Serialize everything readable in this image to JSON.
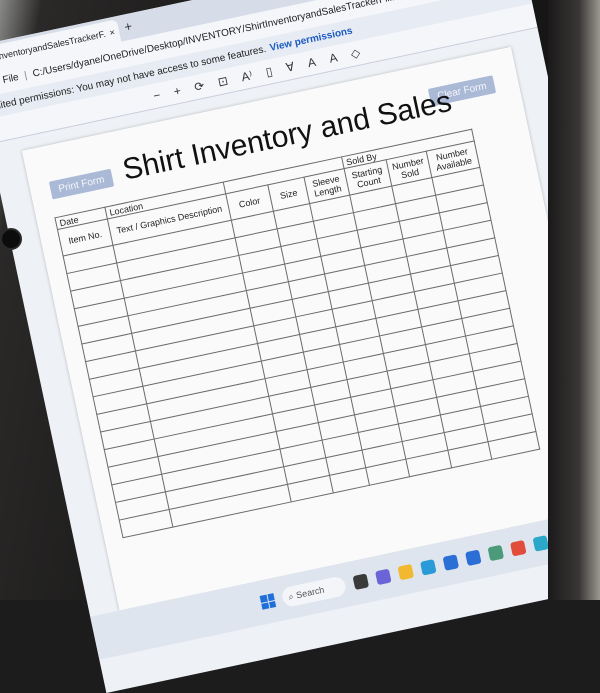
{
  "browser": {
    "tab_title": "ShirtInventoryandSalesTrackerF...",
    "tab_close": "×",
    "new_tab": "+",
    "file_label": "File",
    "file_path": "C:/Users/dyane/OneDrive/Desktop/INVENTORY/ShirtInventoryandSalesTrackerFillable.pdf",
    "permission_text": "limited permissions: You may not have access to some features.",
    "permission_link": "View permissions"
  },
  "pdf_toolbar": {
    "zoom_out": "−",
    "zoom_in": "+",
    "rotate": "⟳",
    "fit": "⊡",
    "read_aloud": "A⁾",
    "page_view": "▯",
    "draw": "∀",
    "text": "A",
    "highlight": "A",
    "erase": "◇"
  },
  "form": {
    "title": "Shirt Inventory and Sales",
    "print_button": "Print Form",
    "clear_button": "Clear Form",
    "group_labels": {
      "date": "Date",
      "location": "Location",
      "sold_by": "Sold By"
    },
    "columns": [
      "Item No.",
      "Text / Graphics Description",
      "Color",
      "Size",
      "Sleeve Length",
      "Starting Count",
      "Number Sold",
      "Number Available"
    ],
    "row_count": 16
  },
  "taskbar": {
    "search_label": "Search",
    "app_icons": [
      {
        "name": "task-view-icon",
        "color": "#3a3a3a"
      },
      {
        "name": "chat-icon",
        "color": "#6b63d8"
      },
      {
        "name": "file-explorer-icon",
        "color": "#f2b830"
      },
      {
        "name": "edge-icon",
        "color": "#2a9bd8"
      },
      {
        "name": "store-icon",
        "color": "#2b6fd6"
      },
      {
        "name": "word-icon",
        "color": "#2b6fd6"
      },
      {
        "name": "teams-icon",
        "color": "#4b9a7a"
      },
      {
        "name": "chrome-icon",
        "color": "#e24c3a"
      },
      {
        "name": "photos-icon",
        "color": "#2aa7c9"
      }
    ]
  }
}
